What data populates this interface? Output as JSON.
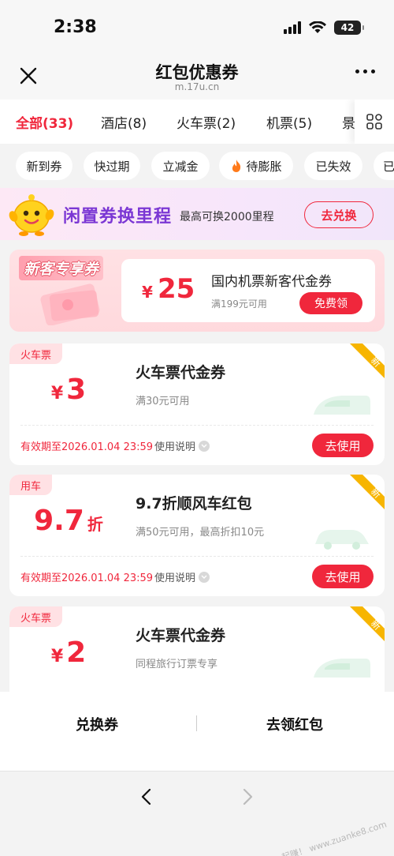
{
  "status_bar": {
    "time": "2:38",
    "battery": "42"
  },
  "header": {
    "title": "红包优惠券",
    "url": "m.17u.cn"
  },
  "tabs": [
    {
      "label": "全部(33)",
      "active": true
    },
    {
      "label": "酒店(8)"
    },
    {
      "label": "火车票(2)"
    },
    {
      "label": "机票(5)"
    },
    {
      "label": "景"
    }
  ],
  "chips": [
    {
      "label": "新到券"
    },
    {
      "label": "快过期"
    },
    {
      "label": "立减金"
    },
    {
      "label": "待膨胀",
      "icon": "fire-icon"
    },
    {
      "label": "已失效"
    },
    {
      "label": "已"
    }
  ],
  "banner": {
    "title": "闲置券换里程",
    "subtitle": "最高可换2000里程",
    "button": "去兑换"
  },
  "newcomer": {
    "tag": "新客专享券",
    "symbol": "¥",
    "amount": "25",
    "title": "国内机票新客代金券",
    "condition": "满199元可用",
    "button": "免费领"
  },
  "coupons": [
    {
      "tag": "火车票",
      "symbol": "¥",
      "amount": "3",
      "unit": "",
      "title": "火车票代金券",
      "condition": "满30元可用",
      "corner": "新",
      "expiry": "有效期至2026.01.04 23:59",
      "help": "使用说明",
      "button": "去使用"
    },
    {
      "tag": "用车",
      "symbol": "",
      "amount": "9.7",
      "unit": "折",
      "title": "9.7折顺风车红包",
      "condition": "满50元可用，最高折扣10元",
      "corner": "新",
      "expiry": "有效期至2026.01.04 23:59",
      "help": "使用说明",
      "button": "去使用"
    },
    {
      "tag": "火车票",
      "symbol": "¥",
      "amount": "2",
      "unit": "",
      "title": "火车票代金券",
      "condition": "同程旅行订票专享",
      "corner": "新"
    }
  ],
  "bottom_bar": {
    "left": "兑换券",
    "right": "去领红包"
  },
  "watermark": "赚客吧，有我一起赚！ www.zuanke8.com",
  "colors": {
    "accent": "#f0273c",
    "banner_title": "#7b37d4",
    "corner_badge": "#f7b500"
  }
}
